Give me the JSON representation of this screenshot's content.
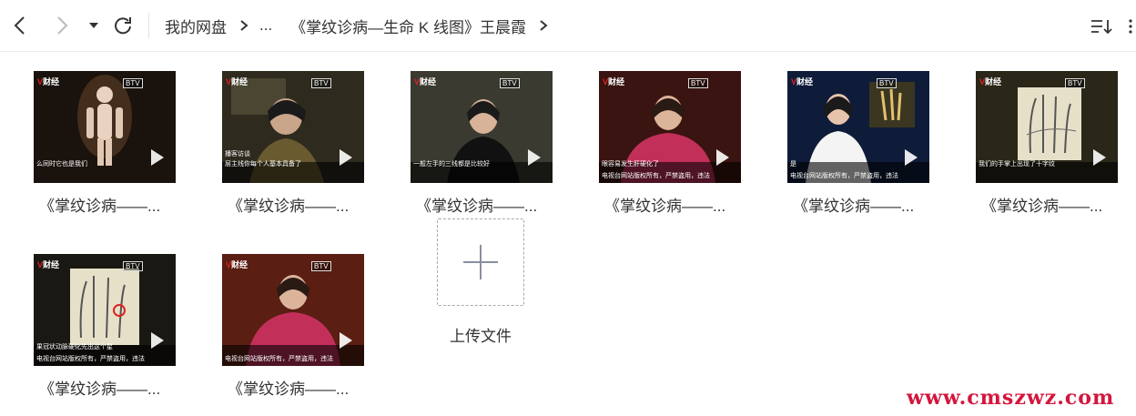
{
  "toolbar": {
    "back_icon": "chevron-left-icon",
    "forward_icon": "chevron-right-icon",
    "dropdown_icon": "caret-down-icon",
    "refresh_icon": "refresh-icon",
    "sort_icon": "sort-icon",
    "more_icon": "more-vertical-icon"
  },
  "breadcrumb": {
    "root": "我的网盘",
    "ellipsis": "...",
    "current": "《掌纹诊病—生命 K 线图》王晨霞"
  },
  "files": [
    {
      "name": "《掌纹诊病——...",
      "caption": "么同时它也是我们",
      "caption2": "",
      "scene": "anatomy"
    },
    {
      "name": "《掌纹诊病——...",
      "caption": "层主线你每个人基本具备了",
      "caption2": "",
      "tag": "播客访谈",
      "scene": "studio"
    },
    {
      "name": "《掌纹诊病——...",
      "caption": "一般左手的三线都是比较好",
      "caption2": "",
      "scene": "woman"
    },
    {
      "name": "《掌纹诊病——...",
      "caption": "眼容易发生肝硬化了",
      "caption2": "电视台网站版权所有，严禁盗用，违法",
      "scene": "pink"
    },
    {
      "name": "《掌纹诊病——...",
      "caption": "是",
      "caption2": "电视台网站版权所有，严禁盗用，违法",
      "scene": "anchor"
    },
    {
      "name": "《掌纹诊病——...",
      "caption": "我们的手掌上出现了十字纹",
      "caption2": "",
      "scene": "palm"
    },
    {
      "name": "《掌纹诊病——...",
      "caption": "果冠状动脉硬化先出这个星",
      "caption2": "电视台网站版权所有，严禁盗用，违法",
      "scene": "palm2"
    },
    {
      "name": "《掌纹诊病——...",
      "caption": "",
      "caption2": "电视台网站版权所有，严禁盗用，违法",
      "scene": "pink2"
    }
  ],
  "upload": {
    "label": "上传文件",
    "icon": "plus-icon"
  },
  "thumb_logo": {
    "mark": "V",
    "text": "财经",
    "channel": "BTV"
  },
  "watermark": "www.cmszwz.com"
}
